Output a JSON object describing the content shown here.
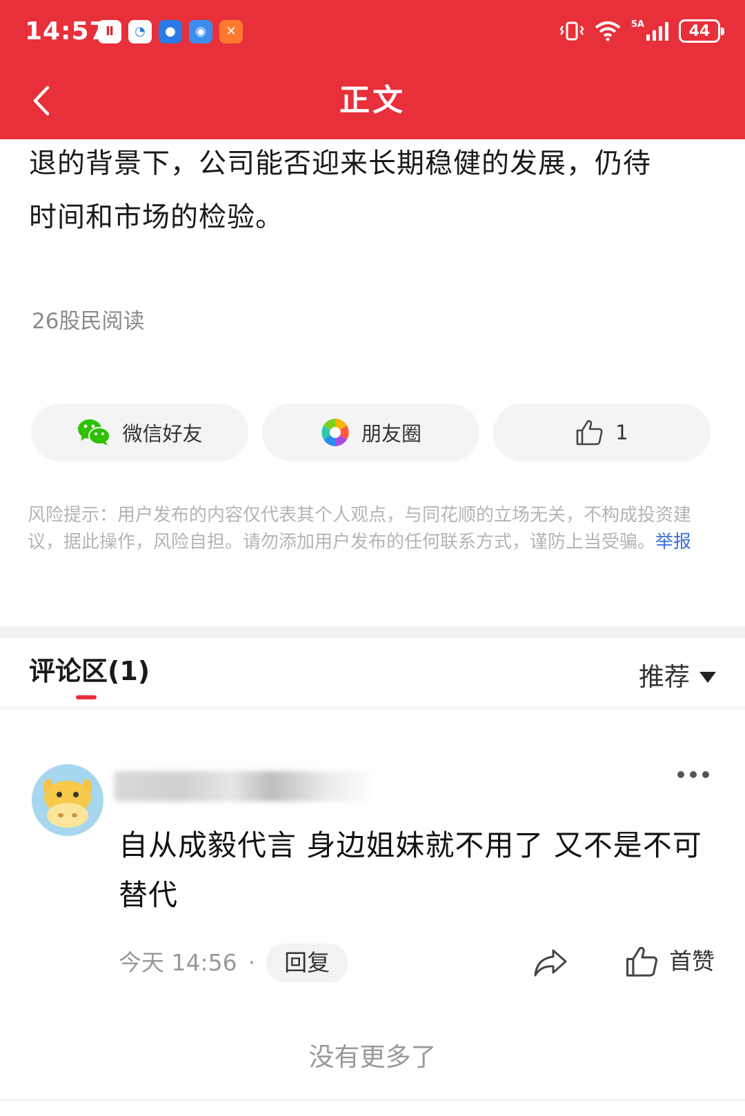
{
  "status_bar": {
    "time": "14:57",
    "network": "5A",
    "battery": "44"
  },
  "header": {
    "title": "正文"
  },
  "article": {
    "text_line_1": "退的背景下，公司能否迎来长期稳健的发展，仍待",
    "text_line_2": "时间和市场的检验。",
    "read_count": "26股民阅读"
  },
  "share": {
    "wechat_label": "微信好友",
    "moments_label": "朋友圈",
    "like_count": "1"
  },
  "risk": {
    "text": "风险提示：用户发布的内容仅代表其个人观点，与同花顺的立场无关，不构成投资建议，据此操作，风险自担。请勿添加用户发布的任何联系方式，谨防上当受骗。",
    "report_label": "举报"
  },
  "comments": {
    "title": "评论区(1)",
    "sort_label": "推荐",
    "items": [
      {
        "text": "自从成毅代言 身边姐妹就不用了 又不是不可替代",
        "time": "今天 14:56",
        "separator": "·",
        "reply_label": "回复",
        "like_label": "首赞"
      }
    ],
    "no_more": "没有更多了"
  },
  "colors": {
    "brand_red": "#e8303a",
    "link_blue": "#3b6fd6"
  }
}
